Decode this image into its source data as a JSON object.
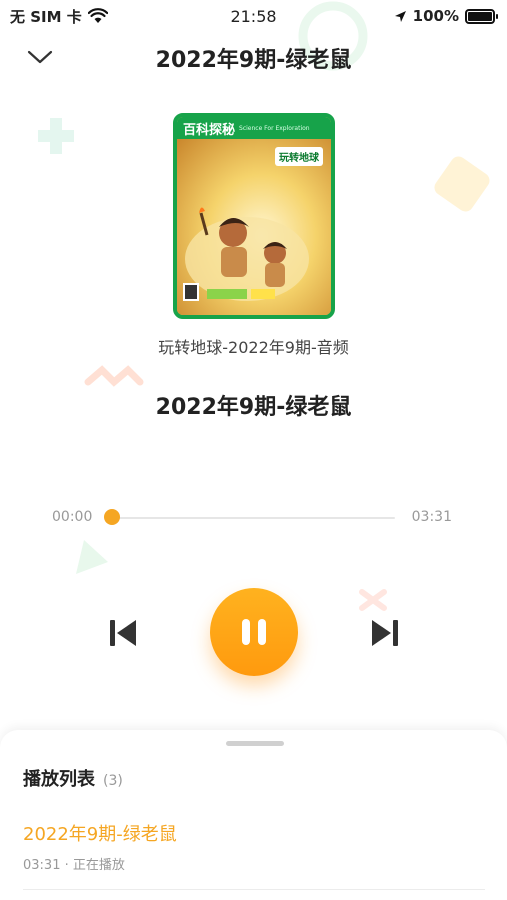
{
  "status_bar": {
    "carrier": "无 SIM 卡",
    "time": "21:58",
    "battery": "100%"
  },
  "header": {
    "title": "2022年9期-绿老鼠"
  },
  "cover": {
    "logo": "百科探秘",
    "subtitle": "Science For Exploration",
    "badge": "玩转地球"
  },
  "player": {
    "album": "玩转地球-2022年9期-音频",
    "track_title": "2022年9期-绿老鼠",
    "current_time": "00:00",
    "total_time": "03:31",
    "progress": 0.0,
    "state": "playing"
  },
  "playlist": {
    "title": "播放列表",
    "count": "(3)",
    "items": [
      {
        "title": "2022年9期-绿老鼠",
        "meta": "03:31 · 正在播放"
      }
    ]
  },
  "colors": {
    "accent": "#f5a623",
    "cover_green": "#17a34a"
  }
}
